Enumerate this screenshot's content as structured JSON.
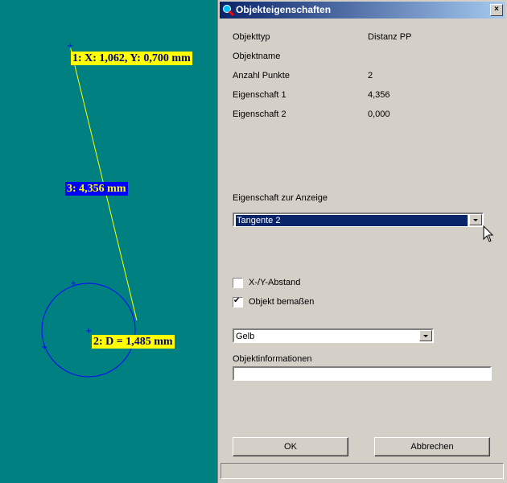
{
  "canvas": {
    "labels": {
      "point1": "1: X: 1,062, Y: 0,700 mm",
      "distance": "3: 4,356 mm",
      "circle": "2: D = 1,485  mm"
    },
    "colors": {
      "background": "#008080",
      "line": "#ffff00",
      "circle": "#0000ff"
    }
  },
  "dialog": {
    "title": "Objekteigenschaften",
    "close_label": "×",
    "properties": [
      {
        "label": "Objekttyp",
        "value": "Distanz PP"
      },
      {
        "label": "Objektname",
        "value": ""
      },
      {
        "label": "Anzahl Punkte",
        "value": "2"
      },
      {
        "label": "Eigenschaft 1",
        "value": "4,356"
      },
      {
        "label": "Eigenschaft 2",
        "value": "0,000"
      }
    ],
    "display_property_label": "Eigenschaft zur Anzeige",
    "display_property_value": "Tangente 2",
    "checkbox_xy": {
      "label": "X-/Y-Abstand",
      "checked": false
    },
    "checkbox_dimension": {
      "label": "Objekt bemaßen",
      "checked": true
    },
    "color_value": "Gelb",
    "info_label": "Objektinformationen",
    "info_value": "",
    "ok_label": "OK",
    "cancel_label": "Abbrechen"
  }
}
